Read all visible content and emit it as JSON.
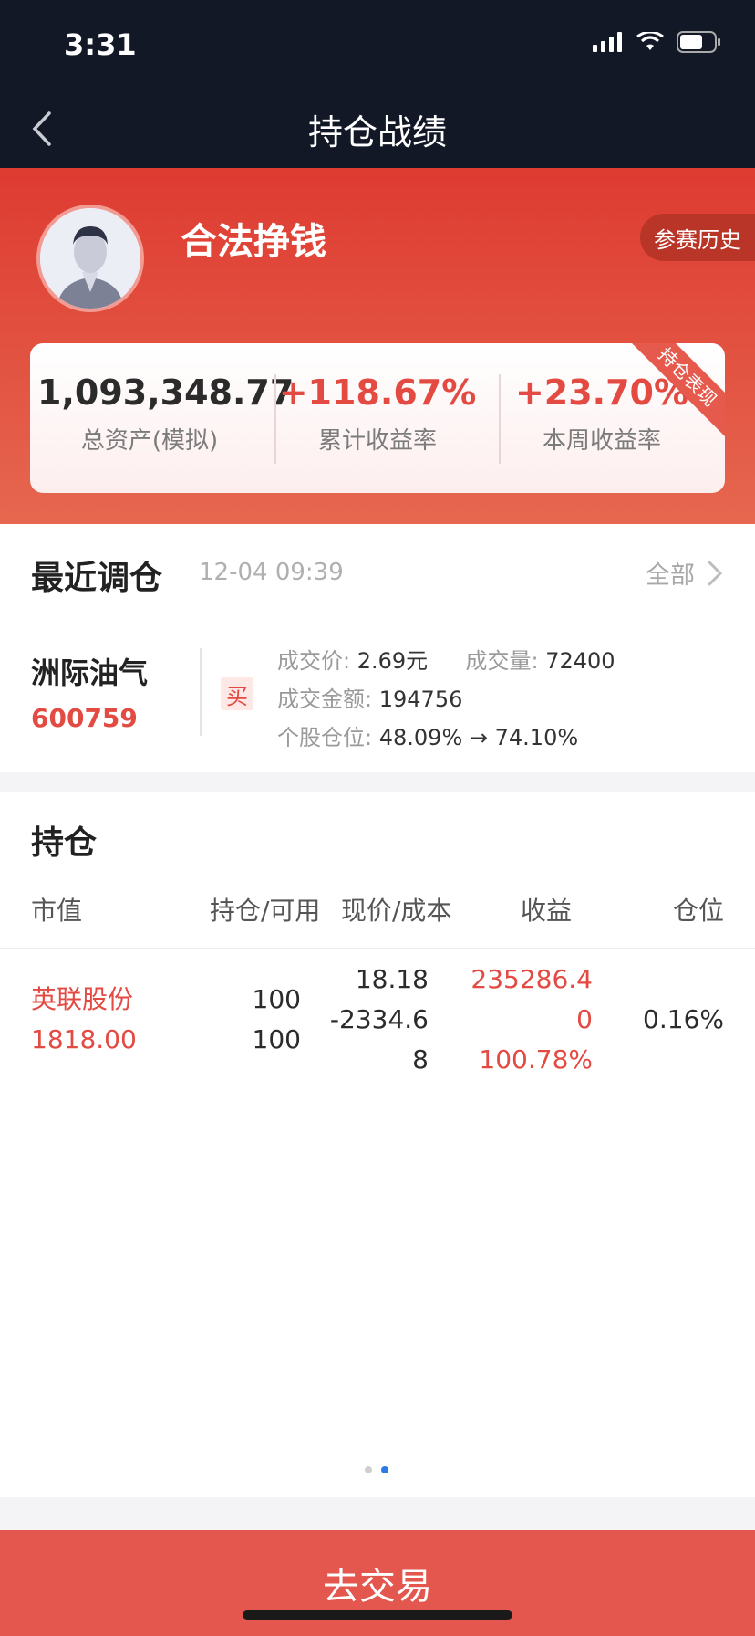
{
  "status_bar": {
    "time": "3:31"
  },
  "nav": {
    "title": "持仓战绩"
  },
  "profile": {
    "username": "合法挣钱",
    "history_label": "参赛历史"
  },
  "stats": {
    "total_assets": "1,093,348.77",
    "total_assets_label": "总资产(模拟)",
    "cumulative_return": "+118.67%",
    "cumulative_return_label": "累计收益率",
    "weekly_return": "+23.70%",
    "weekly_return_label": "本周收益率",
    "ribbon": "持仓表现"
  },
  "recent": {
    "title": "最近调仓",
    "time": "12-04 09:39",
    "all_label": "全部",
    "stock_name": "洲际油气",
    "stock_code": "600759",
    "action": "买",
    "price_label": "成交价:",
    "price_value": "2.69元",
    "volume_label": "成交量:",
    "volume_value": "72400",
    "amount_label": "成交金额:",
    "amount_value": "194756",
    "position_label": "个股仓位:",
    "position_from": "48.09%",
    "position_arrow": "→",
    "position_to": "74.10%"
  },
  "holdings": {
    "title": "持仓",
    "headers": [
      "市值",
      "持仓/可用",
      "现价/成本",
      "收益",
      "仓位"
    ],
    "rows": [
      {
        "name": "英联股份",
        "market_value": "1818.00",
        "holding": "100",
        "available": "100",
        "price_lines": [
          "18.18",
          "-2334.6",
          "8"
        ],
        "profit_lines": [
          "235286.4",
          "0",
          "100.78%"
        ],
        "position": "0.16%"
      }
    ]
  },
  "footer": {
    "trade_label": "去交易"
  },
  "colors": {
    "accent_red": "#e24a42",
    "header_dark": "#121826",
    "button_red": "#e3574e"
  }
}
